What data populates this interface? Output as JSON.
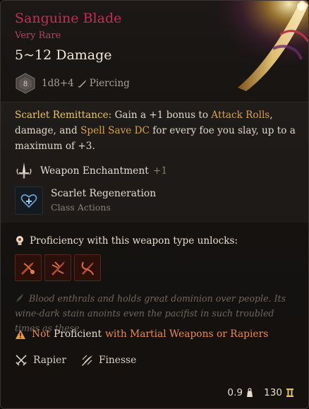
{
  "item": {
    "name": "Sanguine Blade",
    "rarity": "Very Rare",
    "damage": "5~12 Damage",
    "dice_label": "8",
    "dice_formula": "1d8+4",
    "damage_type": "Piercing",
    "damage_type_icon": "dagger-icon"
  },
  "description": {
    "lead": "Scarlet Remittance:",
    "p1": " Gain a +1 bonus to ",
    "k1": "Attack Rolls",
    "p2": ", damage, and ",
    "k2": "Spell Save DC",
    "p3": " for every foe you slay, up to a maximum of +3."
  },
  "enchantment": {
    "label": "Weapon Enchantment",
    "bonus": "+1",
    "icon": "sword-enchantment-icon"
  },
  "action": {
    "title": "Scarlet Regeneration",
    "subtitle": "Class Actions",
    "icon": "heart-regeneration-icon"
  },
  "proficiency": {
    "heading": "Proficiency with this weapon type unlocks:",
    "icon": "lightbulb-icon",
    "slots": [
      "weapon-action-icon-1",
      "weapon-action-icon-2",
      "weapon-action-icon-3"
    ]
  },
  "flavor": "Blood enthrals and holds great dominion over people. Its wine-dark stain anoints even the pacifist in such troubled times as these.",
  "warning": {
    "not": "Not",
    "proficient": "Proficient",
    "rest": "with Martial Weapons or Rapiers",
    "icon": "warning-icon"
  },
  "properties": [
    {
      "label": "Rapier",
      "icon": "crossed-swords-icon"
    },
    {
      "label": "Finesse",
      "icon": "finesse-icon"
    }
  ],
  "footer": {
    "weight": "0.9",
    "weight_icon": "weight-icon",
    "value": "130",
    "value_icon": "gold-coin-icon"
  },
  "colors": {
    "name": "#c52f55",
    "rarity": "#b3435f",
    "keyword": "#d8a24d",
    "warning": "#e98b50",
    "background": "#151210"
  }
}
